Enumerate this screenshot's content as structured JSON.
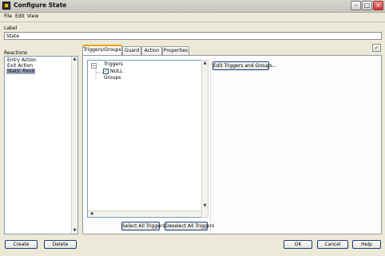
{
  "window": {
    "title": "Configure State"
  },
  "menu": {
    "items": [
      "File",
      "Edit",
      "View"
    ]
  },
  "label_section": {
    "heading": "Label",
    "value": "State"
  },
  "reactions": {
    "heading": "Reactions",
    "items": [
      "Entry Action",
      "Exit Action",
      "Static Rxn0"
    ],
    "selected_index": 2
  },
  "tabs": {
    "items": [
      "Triggers/Groups",
      "Guard",
      "Action",
      "Properties"
    ],
    "active_index": 0
  },
  "tree": {
    "triggers_label": "Triggers",
    "null_label": "NULL",
    "null_checked": true,
    "groups_label": "Groups"
  },
  "buttons": {
    "edit_triggers": "Edit Triggers and Groups...",
    "select_all": "Select All Triggers",
    "deselect_all": "Deselect All Triggers",
    "create": "Create",
    "delete": "Delete",
    "ok": "OK",
    "cancel": "Cancel",
    "help": "Help"
  },
  "icons": {
    "app": "labview-statechart-icon",
    "minimize": "minimize-icon",
    "maximize": "maximize-icon",
    "close": "close-icon",
    "apply": "checkmark-icon",
    "tree_collapse": "collapse-icon",
    "checkbox": "checkbox-icon"
  }
}
